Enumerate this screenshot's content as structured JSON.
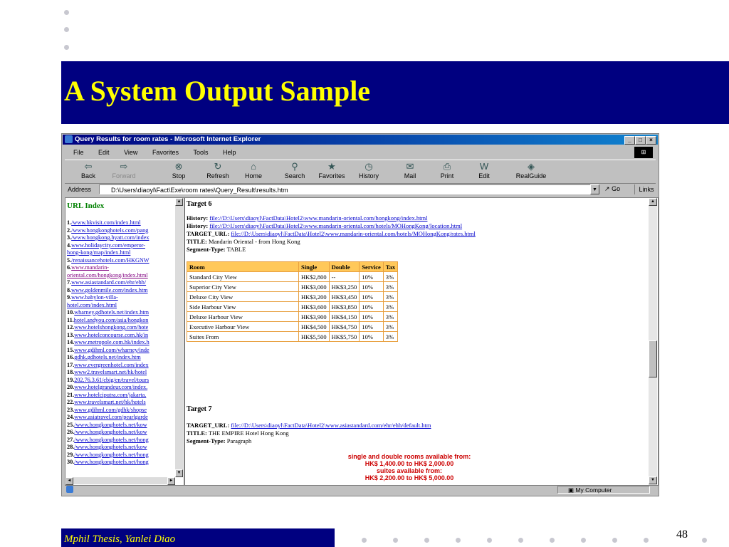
{
  "slide": {
    "title": "A System Output Sample",
    "footer": "Mphil Thesis, Yanlei Diao",
    "page_number": "48"
  },
  "window": {
    "caption": "Query Results for room rates - Microsoft Internet Explorer",
    "controls": {
      "minimize": "_",
      "maximize": "□",
      "close": "×"
    }
  },
  "menu": [
    "File",
    "Edit",
    "View",
    "Favorites",
    "Tools",
    "Help"
  ],
  "toolbar": [
    {
      "label": "Back",
      "icon": "back-arrow-icon",
      "glyph": "⇦"
    },
    {
      "label": "Forward",
      "icon": "forward-arrow-icon",
      "glyph": "⇨"
    },
    {
      "label": "Stop",
      "icon": "stop-icon",
      "glyph": "⊗"
    },
    {
      "label": "Refresh",
      "icon": "refresh-icon",
      "glyph": "↻"
    },
    {
      "label": "Home",
      "icon": "home-icon",
      "glyph": "⌂"
    },
    {
      "label": "Search",
      "icon": "search-icon",
      "glyph": "⚲"
    },
    {
      "label": "Favorites",
      "icon": "favorites-icon",
      "glyph": "★"
    },
    {
      "label": "History",
      "icon": "history-icon",
      "glyph": "◷"
    },
    {
      "label": "Mail",
      "icon": "mail-icon",
      "glyph": "✉"
    },
    {
      "label": "Print",
      "icon": "print-icon",
      "glyph": "⎙"
    },
    {
      "label": "Edit",
      "icon": "edit-icon",
      "glyph": "W"
    },
    {
      "label": "RealGuide",
      "icon": "realguide-icon",
      "glyph": "◈"
    }
  ],
  "address": {
    "label": "Address",
    "value": "D:\\Users\\diaoyl\\Fact\\Exe\\room rates\\Query_Result\\results.htm",
    "go": "Go",
    "links": "Links"
  },
  "left_frame": {
    "title": "URL Index",
    "items": [
      {
        "n": "1.",
        "url": "/www.hkvisit.com/index.html"
      },
      {
        "n": "2.",
        "url": "/www.hongkonghotels.com/pang"
      },
      {
        "n": "3.",
        "url": "/www.hongkong.hyatt.com/index"
      },
      {
        "n": "4.",
        "url": "www.holidaycity.com/emperor-"
      },
      {
        "n": "",
        "url": "hong-kong/map/index.html"
      },
      {
        "n": "5.",
        "url": "/renaissancehotels.com/HKGNW"
      },
      {
        "n": "6.",
        "url": "www.mandarin-",
        "visited": true
      },
      {
        "n": "",
        "url": "oriental.com/hongkong/index.html",
        "visited": true
      },
      {
        "n": "7.",
        "url": "www.asiastandard.com/ehr/ehh/"
      },
      {
        "n": "8.",
        "url": "www.goldenmile.com/index.htm"
      },
      {
        "n": "9.",
        "url": "www.babylon-villa-"
      },
      {
        "n": "",
        "url": "hotel.com/index.html"
      },
      {
        "n": "10.",
        "url": "wharney.gdhotels.net/index.htm"
      },
      {
        "n": "11.",
        "url": "hotel.andyou.com/asia/hongkon"
      },
      {
        "n": "12.",
        "url": "www.hotelshongkong.com/hote"
      },
      {
        "n": "13.",
        "url": "www.hotelconcourse.com.hk/in"
      },
      {
        "n": "14.",
        "url": "www.metropole.com.hk/index.h"
      },
      {
        "n": "15.",
        "url": "www.gdihml.com/wharney/inde"
      },
      {
        "n": "16.",
        "url": "gdhk.gdhotels.net/index.htm"
      },
      {
        "n": "17.",
        "url": "www.evergreenhotel.com/index"
      },
      {
        "n": "18.",
        "url": "www2.travelsmart.net/hk/hotel"
      },
      {
        "n": "19.",
        "url": "202.76.3.61/cbig/en/travel/tours"
      },
      {
        "n": "20.",
        "url": "www.hotelgrandeur.com/index."
      },
      {
        "n": "21.",
        "url": "www.hotelciputra.com/jakarta."
      },
      {
        "n": "22.",
        "url": "www.travelsmart.net/hk/hotels"
      },
      {
        "n": "23.",
        "url": "www.gdihml.com/gdhk/shopse"
      },
      {
        "n": "24.",
        "url": "www.asiatravel.com/pearlgarde"
      },
      {
        "n": "25.",
        "url": "/www.hongkonghotels.net/kow"
      },
      {
        "n": "26.",
        "url": "/www.hongkonghotels.net/kow"
      },
      {
        "n": "27.",
        "url": "/www.hongkonghotels.net/hong"
      },
      {
        "n": "28.",
        "url": "/www.hongkonghotels.net/kow"
      },
      {
        "n": "29.",
        "url": "/www.hongkonghotels.net/hong"
      },
      {
        "n": "30.",
        "url": "/www.hongkonghotels.net/hong"
      }
    ]
  },
  "target6": {
    "heading": "Target 6",
    "history1_label": "History:",
    "history1": "file://D:\\Users\\diaoyl\\FactData\\Hotel2\\www.mandarin-oriental.com/hongkong/index.html",
    "history2_label": "History:",
    "history2": "file://D:\\Users\\diaoyl\\FactData\\Hotel2\\www.mandarin-oriental.com/hotels/MOHongKong/location.html",
    "target_url_label": "TARGET_URL:",
    "target_url": "file://D:\\Users\\diaoyl\\FactData\\Hotel2\\www.mandarin-oriental.com/hotels/MOHongKong/rates.html",
    "title_label": "TITLE:",
    "title": "Mandarin Oriental - from Hong Kong",
    "segment_label": "Segment-Type:",
    "segment": "TABLE",
    "table": {
      "headers": [
        "Room",
        "Single",
        "Double",
        "Service",
        "Tax"
      ],
      "rows": [
        [
          "Standard City View",
          "HK$2,800",
          "--",
          "10%",
          "3%"
        ],
        [
          "Superior City View",
          "HK$3,000",
          "HK$3,250",
          "10%",
          "3%"
        ],
        [
          "Deluxe City View",
          "HK$3,200",
          "HK$3,450",
          "10%",
          "3%"
        ],
        [
          "Side Harbour View",
          "HK$3,600",
          "HK$3,850",
          "10%",
          "3%"
        ],
        [
          "Deluxe Harbour View",
          "HK$3,900",
          "HK$4,150",
          "10%",
          "3%"
        ],
        [
          "Executive Harbour View",
          "HK$4,500",
          "HK$4,750",
          "10%",
          "3%"
        ],
        [
          "Suites From",
          "HK$5,500",
          "HK$5,750",
          "10%",
          "3%"
        ]
      ]
    }
  },
  "target7": {
    "heading": "Target 7",
    "target_url_label": "TARGET_URL:",
    "target_url": "file://D:\\Users\\diaoyl\\FactData\\Hotel2\\www.asiastandard.com/ehr/ehh/default.htm",
    "title_label": "TITLE:",
    "title": "THE EMPIRE Hotel Hong Kong",
    "segment_label": "Segment-Type:",
    "segment": "Paragraph",
    "paragraph": [
      "single and double rooms available from:",
      "HK$ 1,400.00 to HK$ 2,000.00",
      "suites available from:",
      "HK$ 2,200.00 to HK$ 5,000.00"
    ]
  },
  "status": {
    "zone": "My Computer"
  },
  "colors": {
    "title_bg": "#000080",
    "title_fg": "#ffff00",
    "table_header": "#ffc85a",
    "red_text": "#cc0000"
  }
}
